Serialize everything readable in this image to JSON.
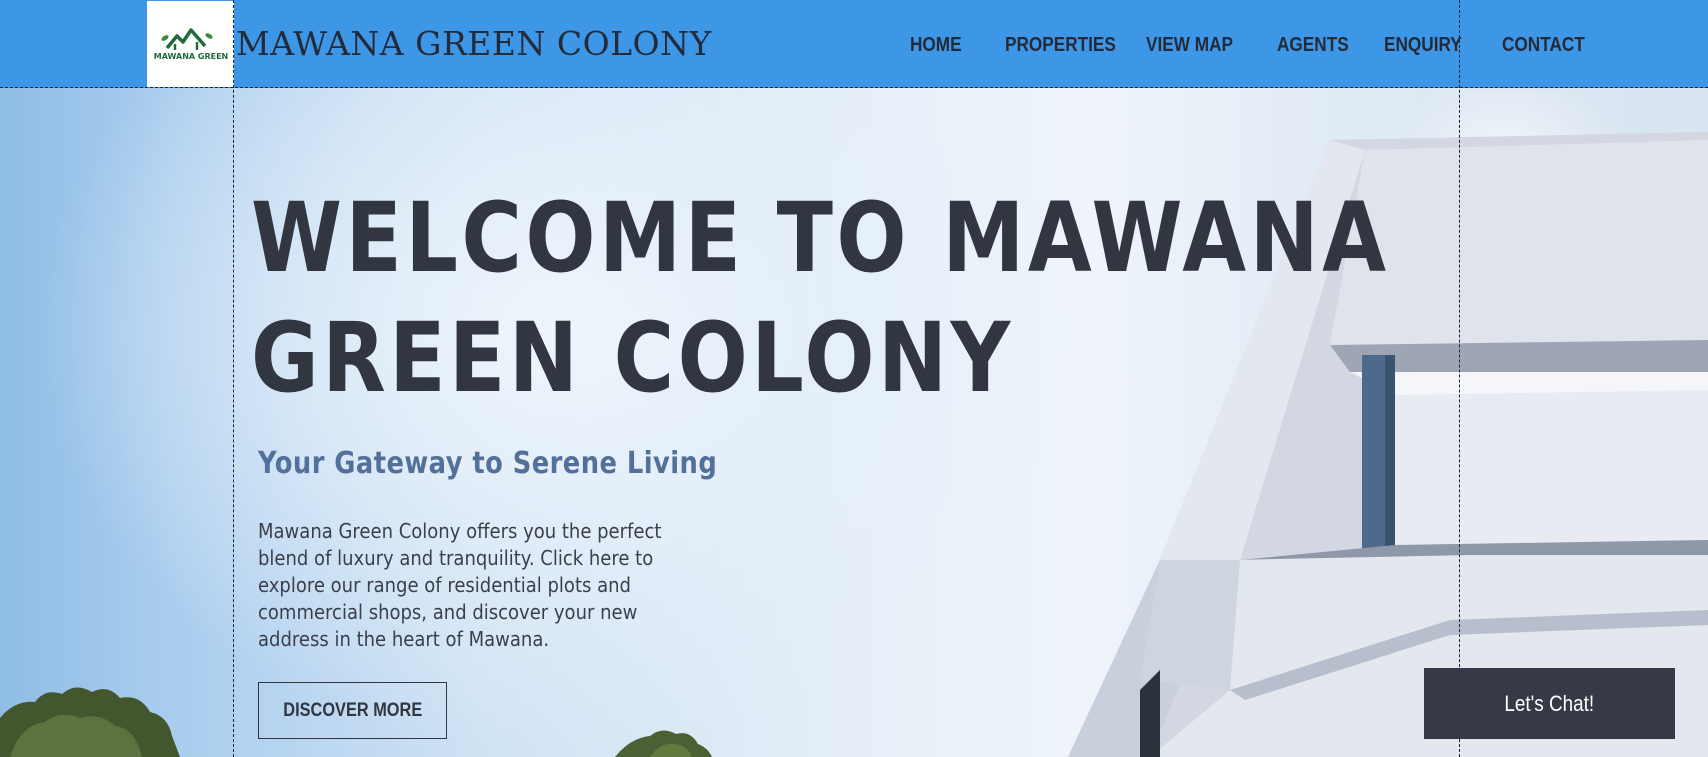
{
  "header": {
    "logo_text": "MAWANA GREEN",
    "site_title": "MAWANA GREEN COLONY",
    "nav": [
      {
        "label": "HOME"
      },
      {
        "label": "PROPERTIES"
      },
      {
        "label": "VIEW MAP"
      },
      {
        "label": "AGENTS"
      },
      {
        "label": "ENQUIRY"
      },
      {
        "label": "CONTACT"
      }
    ]
  },
  "hero": {
    "headline_line1": "WELCOME TO MAWANA",
    "headline_line2": "GREEN COLONY",
    "subheading": "Your Gateway to Serene Living",
    "description": "Mawana Green Colony offers you the perfect blend of luxury and tranquility. Click here to explore our range of residential plots and commercial shops, and discover your new address in the heart of Mawana.",
    "cta_label": "DISCOVER MORE"
  },
  "chat": {
    "label": "Let's Chat!"
  },
  "colors": {
    "header_bg": "#3e97e6",
    "text_dark": "#323641",
    "subheading": "#53709a",
    "chat_bg": "#363a47",
    "logo_green": "#1f6b3a"
  }
}
